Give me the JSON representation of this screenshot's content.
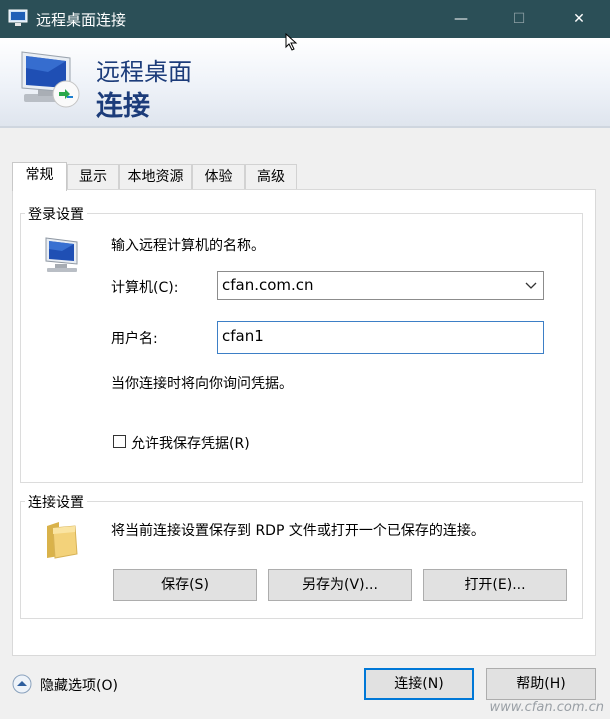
{
  "window": {
    "title": "远程桌面连接",
    "minimize_glyph": "—",
    "maximize_glyph": "☐",
    "close_glyph": "✕",
    "app_icon": "monitor-icon"
  },
  "header": {
    "line1": "远程桌面",
    "line2": "连接"
  },
  "tabs": [
    {
      "label": "常规",
      "active": true
    },
    {
      "label": "显示",
      "active": false
    },
    {
      "label": "本地资源",
      "active": false
    },
    {
      "label": "体验",
      "active": false
    },
    {
      "label": "高级",
      "active": false
    }
  ],
  "login": {
    "group_label": "登录设置",
    "instruction": "输入远程计算机的名称。",
    "computer_label": "计算机(C):",
    "computer_value": "cfan.com.cn",
    "user_label": "用户名:",
    "user_value": "cfan1",
    "prompt_note": "当你连接时将向你询问凭据。",
    "save_credentials_label": "允许我保存凭据(R)",
    "save_credentials_checked": false
  },
  "connection": {
    "group_label": "连接设置",
    "description": "将当前连接设置保存到 RDP 文件或打开一个已保存的连接。",
    "save_label": "保存(S)",
    "save_as_label": "另存为(V)...",
    "open_label": "打开(E)..."
  },
  "footer": {
    "hide_options_label": "隐藏选项(O)",
    "connect_label": "连接(N)",
    "help_label": "帮助(H)"
  },
  "watermark": "www.cfan.com.cn",
  "colors": {
    "titlebar": "#2b4f57",
    "header_text": "#1c3c7a",
    "focus_border": "#3d7fc6",
    "primary_border": "#0078d7"
  }
}
